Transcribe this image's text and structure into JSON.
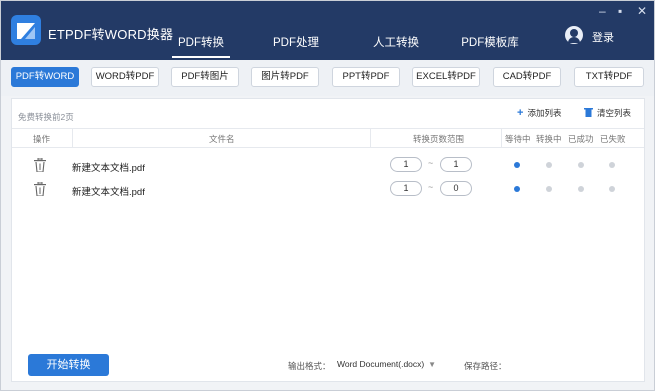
{
  "app": {
    "title": "ETPDF转WORD换器",
    "login": "登录"
  },
  "window_controls": {
    "minimize": "–",
    "maximize": "▪",
    "close": "✕"
  },
  "nav": {
    "tabs": [
      {
        "label": "PDF转换",
        "active": true
      },
      {
        "label": "PDF处理",
        "active": false
      },
      {
        "label": "人工转换",
        "active": false
      },
      {
        "label": "PDF模板库",
        "active": false
      }
    ]
  },
  "functions": {
    "buttons": [
      {
        "label": "PDF转WORD",
        "active": true
      },
      {
        "label": "WORD转PDF",
        "active": false
      },
      {
        "label": "PDF转图片",
        "active": false
      },
      {
        "label": "图片转PDF",
        "active": false
      },
      {
        "label": "PPT转PDF",
        "active": false
      },
      {
        "label": "EXCEL转PDF",
        "active": false
      },
      {
        "label": "CAD转PDF",
        "active": false
      },
      {
        "label": "TXT转PDF",
        "active": false
      }
    ]
  },
  "list": {
    "free_note": "免费转换前2页",
    "add_label": "添加列表",
    "clear_label": "清空列表",
    "columns": {
      "op": "操作",
      "name": "文件名",
      "range": "转换页数范围",
      "waiting": "等待中",
      "converting": "转换中",
      "success": "已成功",
      "failed": "已失败"
    },
    "range_sep": "~",
    "rows": [
      {
        "name": "新建文本文档.pdf",
        "from": "1",
        "to": "1",
        "status": "waiting"
      },
      {
        "name": "新建文本文档.pdf",
        "from": "1",
        "to": "0",
        "status": "waiting"
      }
    ]
  },
  "footer": {
    "start": "开始转换",
    "output_label": "输出格式：",
    "output_value": "Word Document(.docx)",
    "save_label": "保存路径："
  },
  "colors": {
    "header": "#233a66",
    "accent": "#2b79d8",
    "inactive_dot": "#cfd3d9"
  }
}
